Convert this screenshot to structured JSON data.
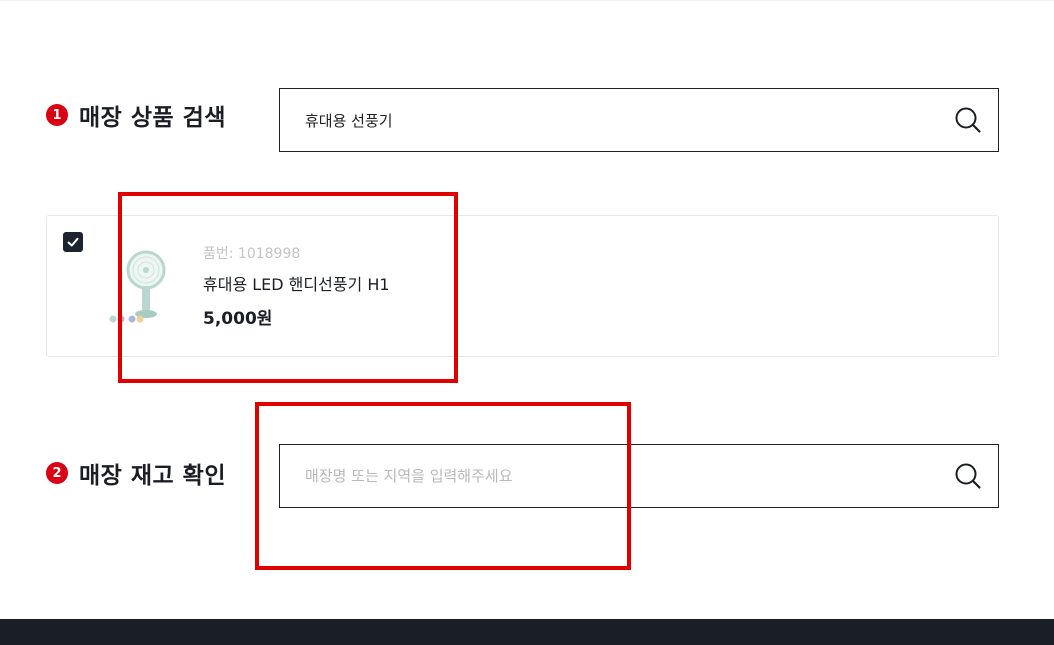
{
  "section1": {
    "step": "1",
    "title": "매장 상품 검색",
    "search_value": "휴대용 선풍기",
    "search_icon": "search-icon"
  },
  "product": {
    "checked": true,
    "code": "품번: 1018998",
    "name": "휴대용 LED 핸디선풍기 H1",
    "price": "5,000원",
    "color_options": [
      "#b9d7cf",
      "#a9b8d8",
      "#f0cf9b"
    ]
  },
  "section2": {
    "step": "2",
    "title": "매장 재고 확인",
    "search_placeholder": "매장명 또는 지역을 입력해주세요",
    "search_icon": "search-icon"
  },
  "colors": {
    "accent_red": "#d80012",
    "highlight_red": "#e00000",
    "dark": "#1d2430",
    "footer": "#1a1f26"
  }
}
